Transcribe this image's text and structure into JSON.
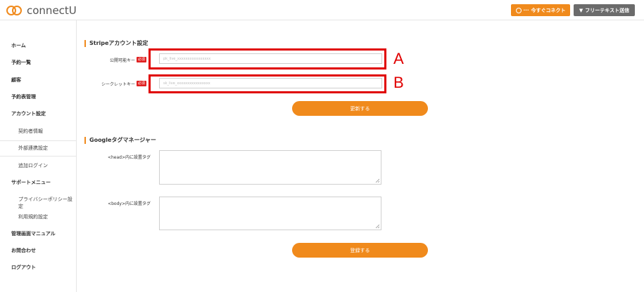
{
  "header": {
    "logo_text": "connectU",
    "connect_button": "今すぐコネクト",
    "freetext_button": "フリーテキスト送信"
  },
  "sidebar": {
    "items": [
      {
        "label": "ホーム"
      },
      {
        "label": "予約一覧"
      },
      {
        "label": "顧客"
      },
      {
        "label": "予約表管理"
      },
      {
        "label": "アカウント設定"
      },
      {
        "label": "契約者情報"
      },
      {
        "label": "外部連携設定"
      },
      {
        "label": "追加ログイン"
      },
      {
        "label": "サポートメニュー"
      },
      {
        "label": "プライバシーポリシー設定"
      },
      {
        "label": "利用規約設定"
      },
      {
        "label": "管理画面マニュアル"
      },
      {
        "label": "お問合わせ"
      },
      {
        "label": "ログアウト"
      }
    ]
  },
  "stripe": {
    "title": "Stripeアカウント設定",
    "public_key_label": "公開可能キー",
    "secret_key_label": "シークレットキー",
    "required_badge": "必須",
    "public_key_placeholder": "pk_live_xxxxxxxxxxxxxxxx",
    "secret_key_placeholder": "sk_live_xxxxxxxxxxxxxxxx",
    "update_button": "更新する"
  },
  "annotations": {
    "a": "A",
    "b": "B"
  },
  "gtm": {
    "title": "Googleタグマネージャー",
    "head_label": "<head>内に設置タグ",
    "body_label": "<body>内に設置タグ",
    "register_button": "登録する"
  },
  "colors": {
    "accent": "#f08a1c",
    "required": "#e02020",
    "annotation": "#e00000"
  }
}
